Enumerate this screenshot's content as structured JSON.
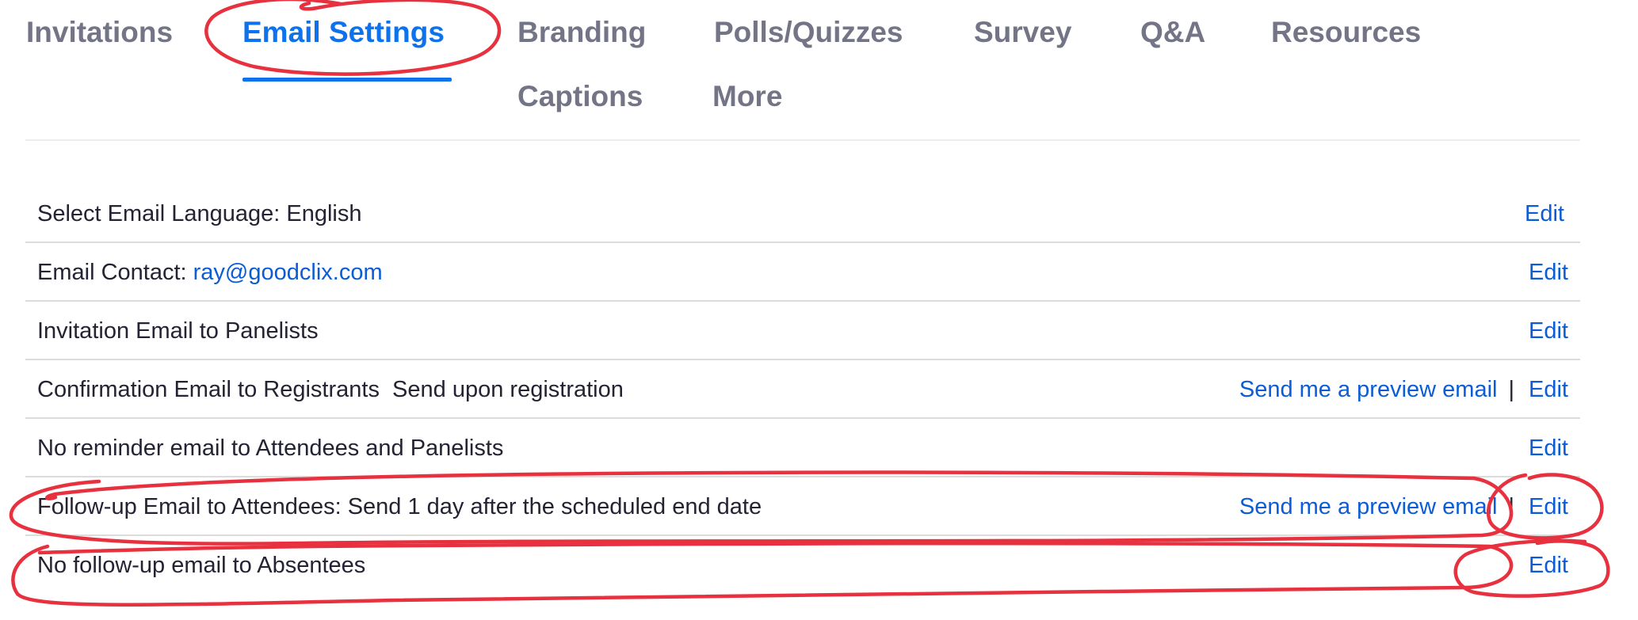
{
  "tabs": [
    {
      "label": "Invitations",
      "active": false
    },
    {
      "label": "Email Settings",
      "active": true
    },
    {
      "label": "Branding",
      "active": false
    },
    {
      "label": "Polls/Quizzes",
      "active": false
    },
    {
      "label": "Survey",
      "active": false
    },
    {
      "label": "Q&A",
      "active": false
    },
    {
      "label": "Resources",
      "active": false
    },
    {
      "label": "Captions",
      "active": false
    },
    {
      "label": "More",
      "active": false
    }
  ],
  "rows": [
    {
      "label": "Select Email Language: English",
      "actions": {
        "edit": "Edit"
      }
    },
    {
      "label": "Email Contact: ",
      "value": "ray@goodclix.com",
      "actions": {
        "edit": "Edit"
      }
    },
    {
      "label": "Invitation Email to Panelists",
      "actions": {
        "edit": "Edit"
      }
    },
    {
      "label": "Confirmation Email to Registrants  Send upon registration",
      "actions": {
        "preview": "Send me a preview email",
        "separator": "|",
        "edit": "Edit"
      }
    },
    {
      "label": "No reminder email to Attendees and Panelists",
      "actions": {
        "edit": "Edit"
      }
    },
    {
      "label": "Follow-up Email to Attendees: Send 1 day after the scheduled end date",
      "actions": {
        "preview": "Send me a preview email",
        "separator": "|",
        "edit": "Edit"
      }
    },
    {
      "label": "No follow-up email to Absentees",
      "actions": {
        "edit": "Edit"
      }
    }
  ],
  "colors": {
    "active_tab": "#0e72ed",
    "inactive_tab": "#747487",
    "link": "#0b5cd5",
    "text": "#232333",
    "annotation": "#e8313f"
  }
}
